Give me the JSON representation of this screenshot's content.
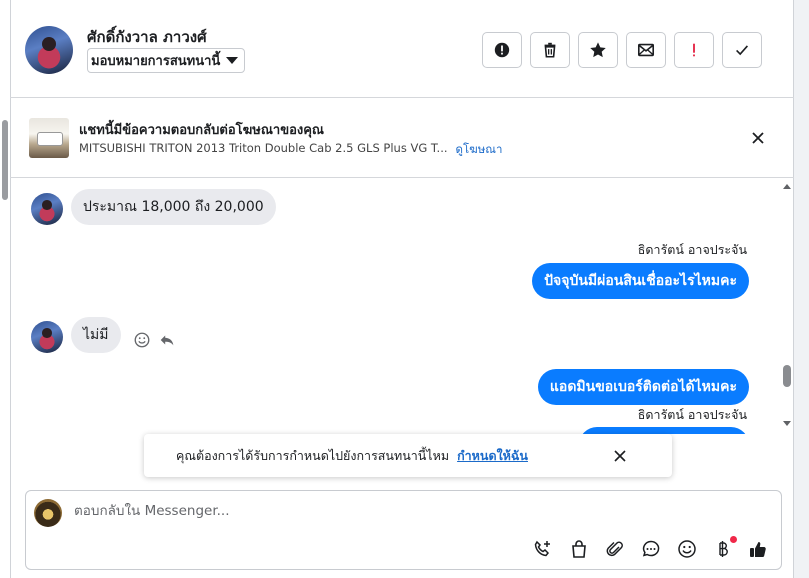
{
  "header": {
    "contact_name": "ศักดิ์กังวาล ภาวงศ์",
    "assign_label": "มอบหมายการสนทนานี้",
    "actions": [
      {
        "name": "report-icon",
        "label": "Spam"
      },
      {
        "name": "trash-icon",
        "label": "Delete"
      },
      {
        "name": "star-icon",
        "label": "Star"
      },
      {
        "name": "mail-icon",
        "label": "Mark unread"
      },
      {
        "name": "priority-icon",
        "label": "!"
      },
      {
        "name": "check-icon",
        "label": "Done"
      }
    ]
  },
  "ad": {
    "title": "แชทนี้มีข้อความตอบกลับต่อโฆษณาของคุณ",
    "subtitle": "MITSUBISHI TRITON 2013 Triton Double Cab 2.5 GLS Plus VG T...",
    "link": "ดูโฆษณา"
  },
  "messages": [
    {
      "direction": "in",
      "text": "ประมาณ 18,000 ถึง 20,000"
    },
    {
      "direction": "out",
      "sender": "ธิดารัตน์ อาจประจัน",
      "text": "ปัจจุบันมีผ่อนสินเชื่ออะไรไหมคะ"
    },
    {
      "direction": "in",
      "text": "ไม่มี"
    },
    {
      "direction": "out",
      "text": "แอดมินขอเบอร์ติดต่อได้ไหมคะ"
    },
    {
      "direction": "out",
      "sender": "ธิดารัตน์ อาจประจัน",
      "text": ""
    }
  ],
  "toast": {
    "text": "คุณต้องการได้รับการกำหนดไปยังการสนทนานี้ไหม",
    "link": "กำหนดให้ฉัน"
  },
  "composer": {
    "placeholder": "ตอบกลับใน Messenger...",
    "icons": [
      "add-call-icon",
      "shopping-bag-icon",
      "attachment-icon",
      "saved-reply-icon",
      "emoji-icon",
      "payment-icon",
      "like-icon"
    ]
  },
  "colors": {
    "outgoing_bubble": "#0a7cff",
    "incoming_bubble": "#e9eaee",
    "link": "#1b6ac9",
    "priority": "#e41e3f"
  }
}
